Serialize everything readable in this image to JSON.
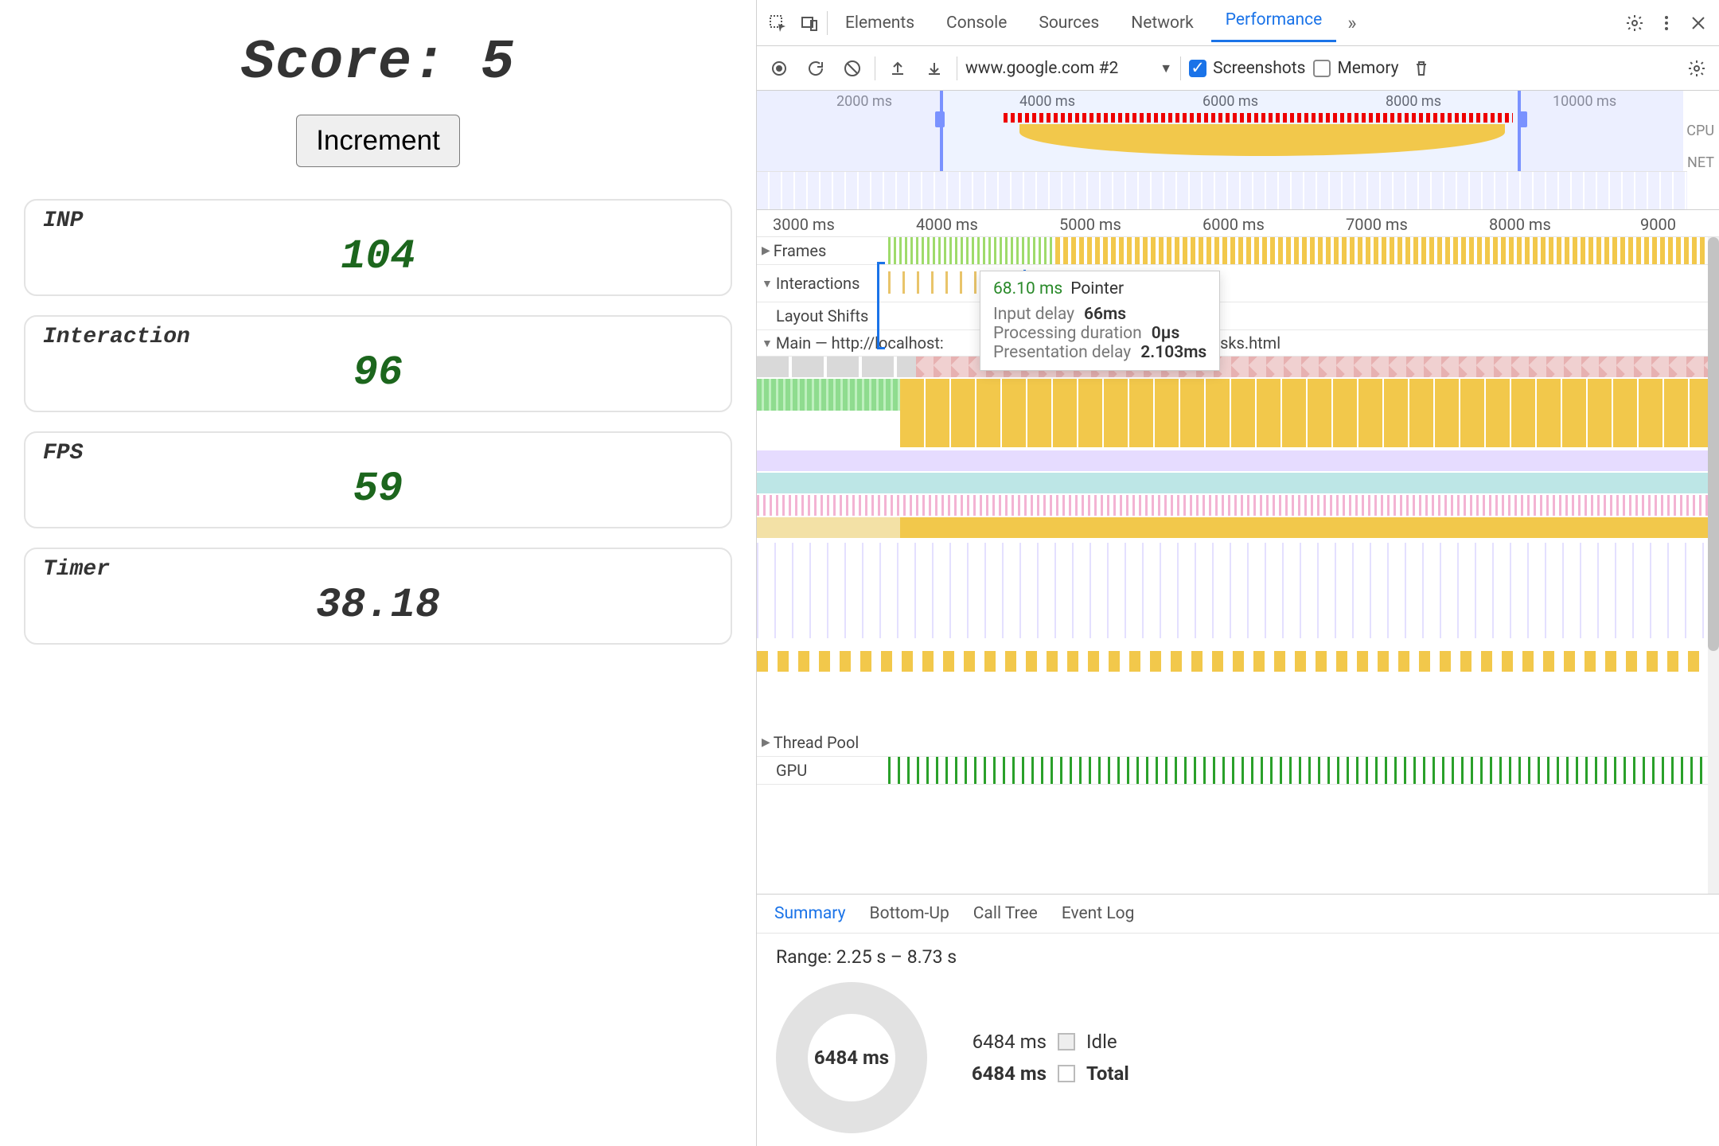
{
  "app": {
    "score_label": "Score:",
    "score_value": "5",
    "increment_label": "Increment",
    "metrics": {
      "inp": {
        "label": "INP",
        "value": "104"
      },
      "interaction": {
        "label": "Interaction",
        "value": "96"
      },
      "fps": {
        "label": "FPS",
        "value": "59"
      },
      "timer": {
        "label": "Timer",
        "value": "38.18"
      }
    }
  },
  "devtools": {
    "tabs": {
      "elements": "Elements",
      "console": "Console",
      "sources": "Sources",
      "network": "Network",
      "performance": "Performance"
    },
    "toolbar": {
      "recording_label": "www.google.com #2",
      "screenshots": "Screenshots",
      "memory": "Memory"
    },
    "overview": {
      "ticks": {
        "t1": "2000 ms",
        "t2": "4000 ms",
        "t3": "6000 ms",
        "t4": "8000 ms",
        "t5": "10000 ms"
      },
      "cpu": "CPU",
      "net": "NET"
    },
    "ruler": {
      "t1": "3000 ms",
      "t2": "4000 ms",
      "t3": "5000 ms",
      "t4": "6000 ms",
      "t5": "7000 ms",
      "t6": "8000 ms",
      "t7": "9000"
    },
    "tracks": {
      "frames": "Frames",
      "interactions": "Interactions",
      "layout_shifts": "Layout Shifts",
      "main_prefix": "Main — http://localhost:",
      "main_suffix": "small_tasks.html",
      "thread_pool": "Thread Pool",
      "gpu": "GPU"
    },
    "tooltip": {
      "time": "68.10 ms",
      "type": "Pointer",
      "rows": {
        "input_delay_label": "Input delay",
        "input_delay_value": "66ms",
        "processing_label": "Processing duration",
        "processing_value": "0µs",
        "presentation_label": "Presentation delay",
        "presentation_value": "2.103ms"
      }
    },
    "bottom": {
      "tabs": {
        "summary": "Summary",
        "bottomup": "Bottom-Up",
        "calltree": "Call Tree",
        "eventlog": "Event Log"
      },
      "range": "Range: 2.25 s – 8.73 s",
      "donut_center": "6484 ms",
      "legend": {
        "idle_time": "6484 ms",
        "idle_label": "Idle",
        "total_time": "6484 ms",
        "total_label": "Total"
      }
    }
  }
}
